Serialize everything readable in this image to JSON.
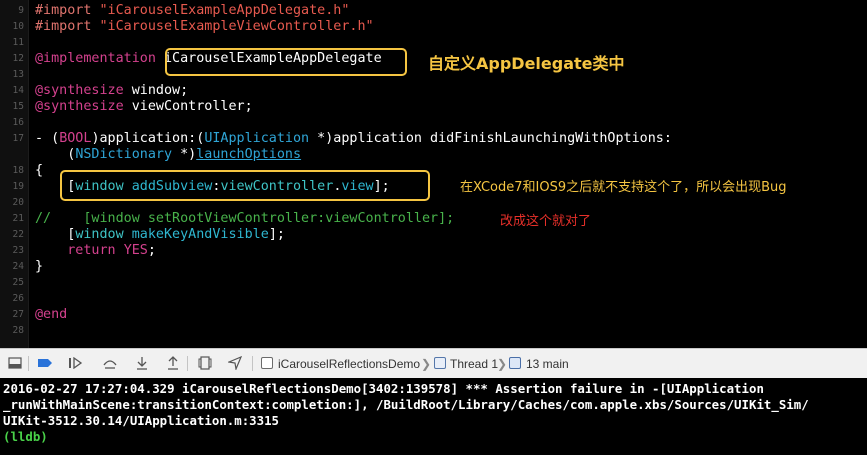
{
  "editor": {
    "lines": [
      {
        "n": "9",
        "tokens": [
          {
            "t": "#import ",
            "c": "pp"
          },
          {
            "t": "\"iCarouselExampleAppDelegate.h\"",
            "c": "str"
          }
        ]
      },
      {
        "n": "10",
        "tokens": [
          {
            "t": "#import ",
            "c": "pp"
          },
          {
            "t": "\"iCarouselExampleViewController.h\"",
            "c": "str"
          }
        ]
      },
      {
        "n": "11",
        "tokens": []
      },
      {
        "n": "12",
        "tokens": [
          {
            "t": "@implementation ",
            "c": "kw"
          },
          {
            "t": "iCarouselExampleAppDelegate",
            "c": "tx"
          }
        ]
      },
      {
        "n": "13",
        "tokens": []
      },
      {
        "n": "14",
        "tokens": [
          {
            "t": "@synthesize",
            "c": "kw"
          },
          {
            "t": " window;",
            "c": "tx"
          }
        ]
      },
      {
        "n": "15",
        "tokens": [
          {
            "t": "@synthesize",
            "c": "kw"
          },
          {
            "t": " viewController;",
            "c": "tx"
          }
        ]
      },
      {
        "n": "16",
        "tokens": []
      },
      {
        "n": "17",
        "tokens": [
          {
            "t": "- (",
            "c": "tx"
          },
          {
            "t": "BOOL",
            "c": "kw"
          },
          {
            "t": ")application:(",
            "c": "tx"
          },
          {
            "t": "UIApplication",
            "c": "ty"
          },
          {
            "t": " *)application didFinishLaunchingWithOptions:",
            "c": "tx"
          }
        ]
      },
      {
        "n": "",
        "tokens": [
          {
            "t": "    (",
            "c": "tx"
          },
          {
            "t": "NSDictionary",
            "c": "ty"
          },
          {
            "t": " *)",
            "c": "tx"
          },
          {
            "t": "launchOptions",
            "c": "ty ul"
          }
        ]
      },
      {
        "n": "18",
        "tokens": [
          {
            "t": "{",
            "c": "tx"
          }
        ]
      },
      {
        "n": "19",
        "tokens": [
          {
            "t": "    [",
            "c": "tx"
          },
          {
            "t": "window",
            "c": "pr"
          },
          {
            "t": " ",
            "c": "tx"
          },
          {
            "t": "addSubview",
            "c": "mt"
          },
          {
            "t": ":",
            "c": "tx"
          },
          {
            "t": "viewController",
            "c": "pr"
          },
          {
            "t": ".",
            "c": "tx"
          },
          {
            "t": "view",
            "c": "mt"
          },
          {
            "t": "];",
            "c": "tx"
          }
        ]
      },
      {
        "n": "20",
        "tokens": []
      },
      {
        "n": "21",
        "tokens": [
          {
            "t": "//    [window setRootViewController:viewController];",
            "c": "cm"
          }
        ]
      },
      {
        "n": "22",
        "tokens": [
          {
            "t": "    [",
            "c": "tx"
          },
          {
            "t": "window",
            "c": "pr"
          },
          {
            "t": " ",
            "c": "tx"
          },
          {
            "t": "makeKeyAndVisible",
            "c": "mt"
          },
          {
            "t": "];",
            "c": "tx"
          }
        ]
      },
      {
        "n": "23",
        "tokens": [
          {
            "t": "    ",
            "c": "tx"
          },
          {
            "t": "return",
            "c": "kw"
          },
          {
            "t": " ",
            "c": "tx"
          },
          {
            "t": "YES",
            "c": "kw"
          },
          {
            "t": ";",
            "c": "tx"
          }
        ]
      },
      {
        "n": "24",
        "tokens": [
          {
            "t": "}",
            "c": "tx"
          }
        ]
      },
      {
        "n": "25",
        "tokens": []
      },
      {
        "n": "26",
        "tokens": []
      },
      {
        "n": "27",
        "tokens": [
          {
            "t": "@end",
            "c": "kw"
          }
        ]
      },
      {
        "n": "28",
        "tokens": []
      }
    ]
  },
  "annotations": {
    "appdelegate_note": "自定义AppDelegate类中",
    "xcode7_note": "在XCode7和IOS9之后就不支持这个了，所以会出现Bug",
    "fix_note": "改成这个就对了",
    "colors": {
      "box": "#f5c542",
      "yellow_text": "#f5c542",
      "red_text": "#e8302a"
    }
  },
  "debug_bar": {
    "breadcrumb": [
      {
        "label": "iCarouselReflectionsDemo",
        "icon": "app-icon"
      },
      {
        "label": "Thread 1",
        "icon": "thread-icon"
      },
      {
        "label": "13 main",
        "icon": "stack-frame-icon"
      }
    ]
  },
  "console": {
    "lines": [
      "2016-02-27 17:27:04.329 iCarouselReflectionsDemo[3402:139578] *** Assertion failure in -[UIApplication",
      "_runWithMainScene:transitionContext:completion:], /BuildRoot/Library/Caches/com.apple.xbs/Sources/UIKit_Sim/",
      "UIKit-3512.30.14/UIApplication.m:3315"
    ],
    "prompt": "(lldb)"
  }
}
